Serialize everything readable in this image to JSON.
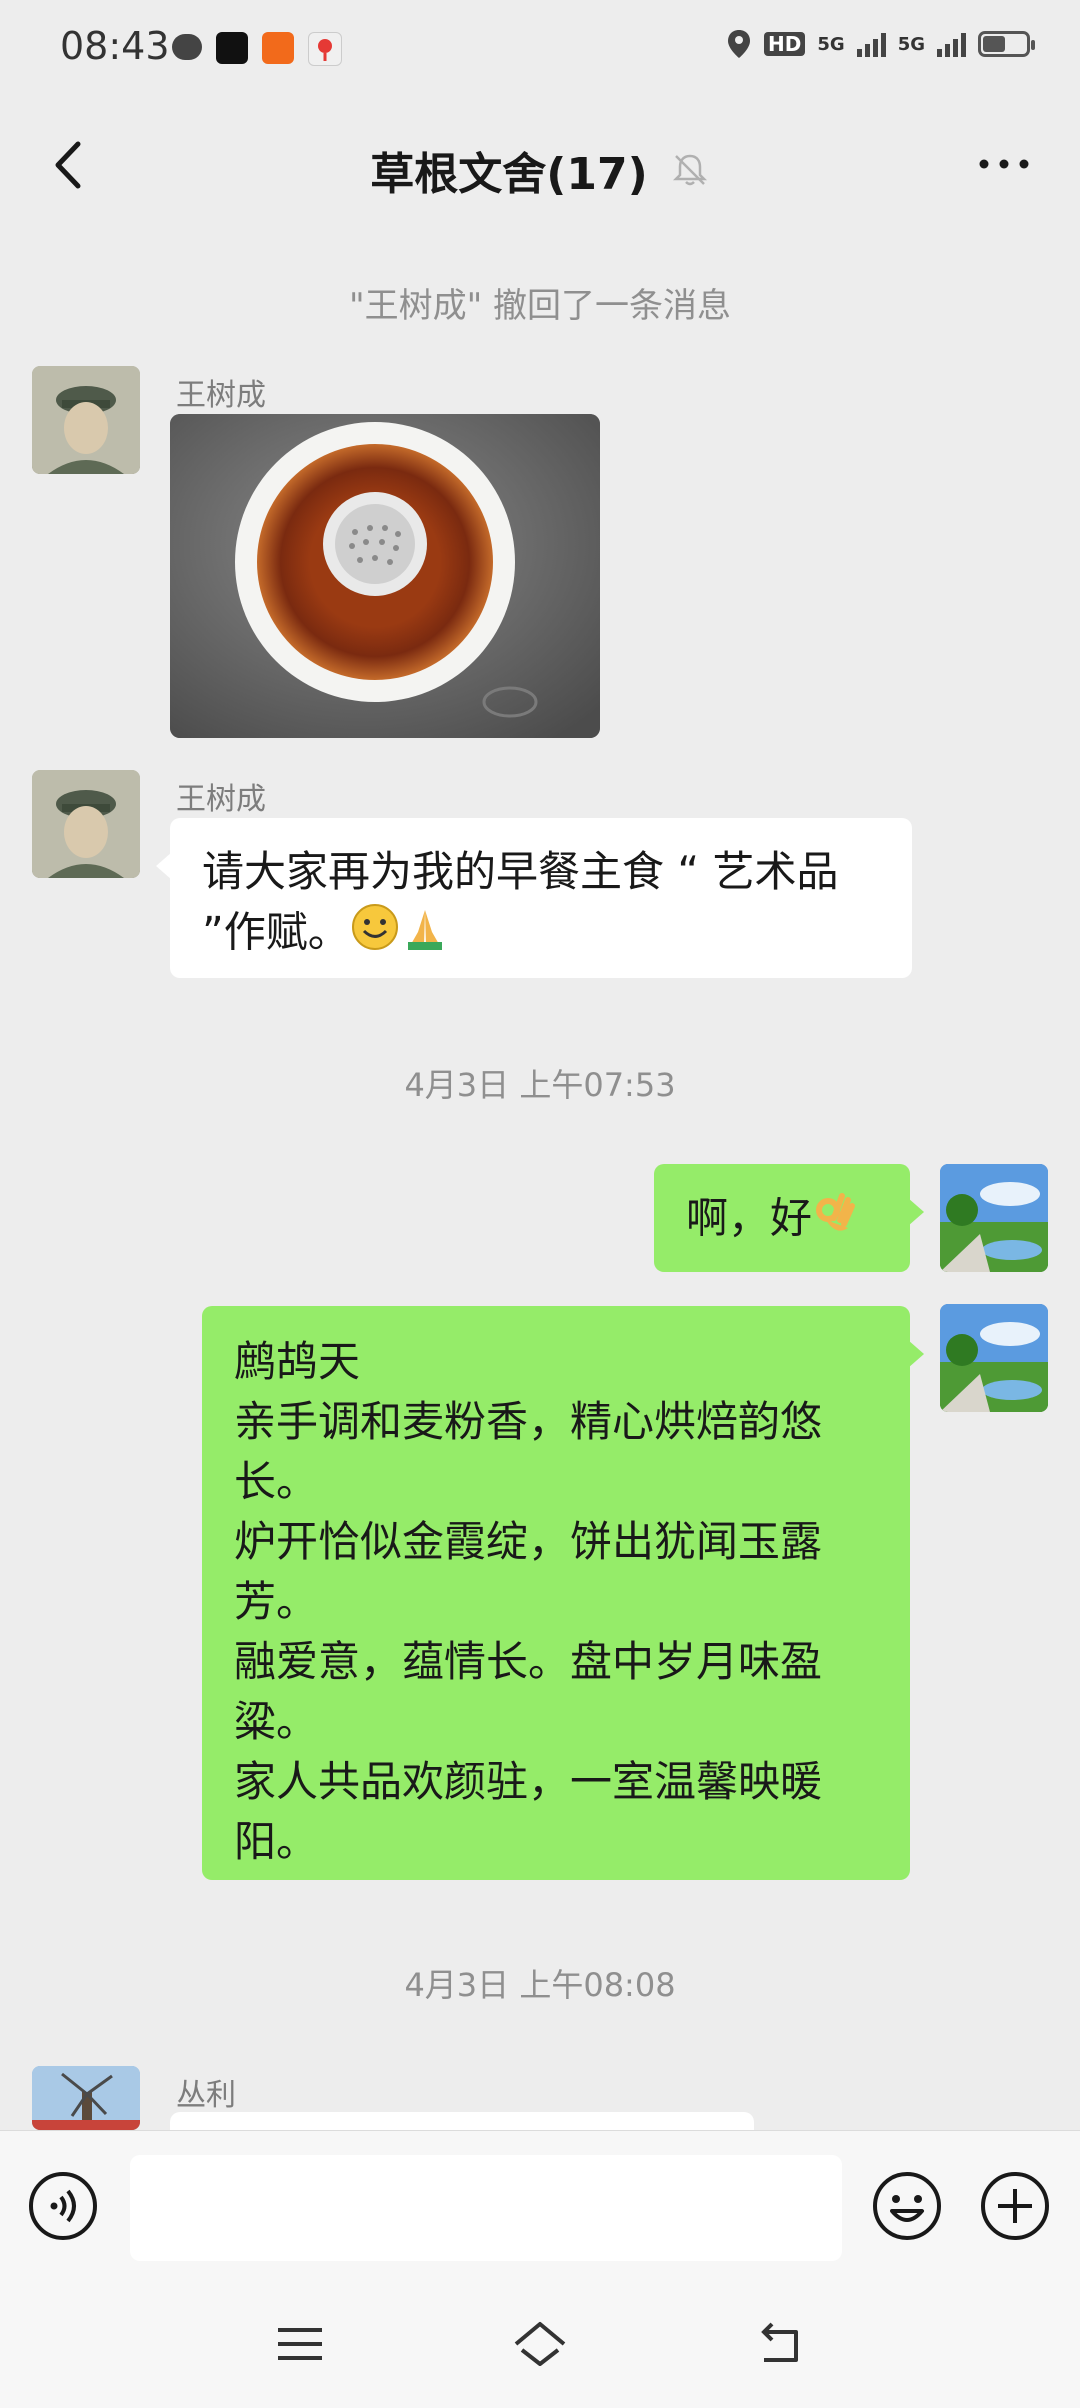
{
  "status_bar": {
    "time": "08:43",
    "network": "5G",
    "network2": "5G",
    "hd": "HD"
  },
  "header": {
    "title": "草根文舍(17)"
  },
  "messages": {
    "recall_notice": "\"王树成\" 撤回了一条消息",
    "msg1_sender": "王树成",
    "msg2_sender": "王树成",
    "msg2_text": "请大家再为我的早餐主食 “ 艺术品 ”作赋。",
    "time1": "4月3日 上午07:53",
    "msg3_text": "啊，好",
    "poem": [
      "鹧鸪天",
      "亲手调和麦粉香，精心烘焙韵悠长。",
      "炉开恰似金霞绽，饼出犹闻玉露芳。",
      "融爱意，蕴情长。盘中岁月味盈粱。",
      "家人共品欢颜驻，一室温馨映暖阳。"
    ],
    "time2": "4月3日 上午08:08",
    "msg5_sender": "丛利"
  },
  "colors": {
    "chat_bg": "#ededed",
    "my_bubble": "#95ec69",
    "other_bubble": "#ffffff"
  }
}
